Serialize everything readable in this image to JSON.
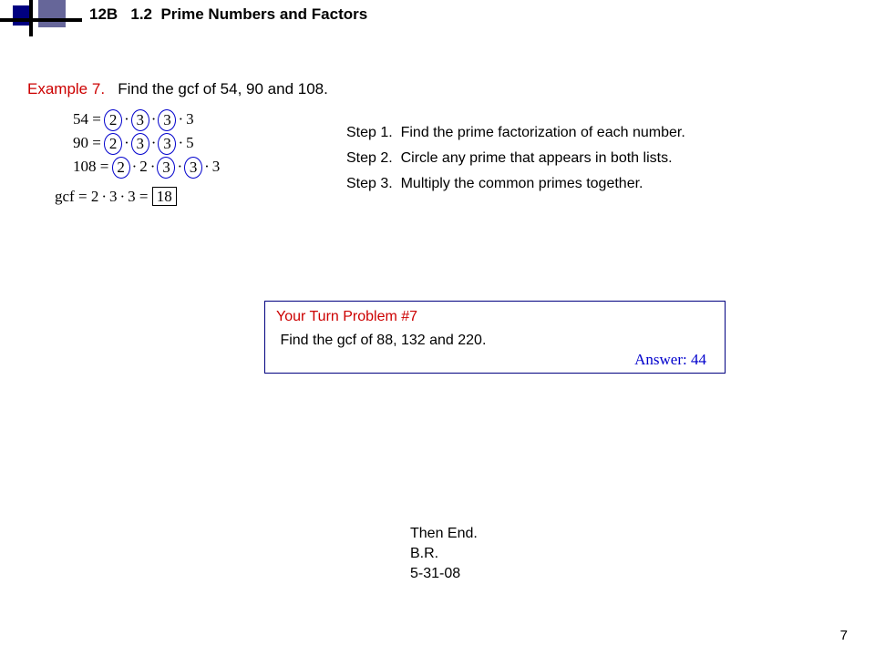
{
  "header": {
    "course": "12B",
    "section": "1.2",
    "title": "Prime Numbers and Factors"
  },
  "example": {
    "label": "Example 7.",
    "prompt": "Find the gcf of 54, 90 and 108."
  },
  "factorizations": [
    {
      "lhs": "54",
      "factors": [
        "2",
        "3",
        "3",
        "3"
      ],
      "circled": [
        true,
        true,
        true,
        false
      ]
    },
    {
      "lhs": "90",
      "factors": [
        "2",
        "3",
        "3",
        "5"
      ],
      "circled": [
        true,
        true,
        true,
        false
      ]
    },
    {
      "lhs": "108",
      "factors": [
        "2",
        "2",
        "3",
        "3",
        "3"
      ],
      "circled": [
        true,
        false,
        true,
        true,
        false
      ]
    }
  ],
  "gcf": {
    "label": "gcf",
    "expr_factors": [
      "2",
      "3",
      "3"
    ],
    "result": "18"
  },
  "steps": [
    {
      "label": "Step 1.",
      "text": "Find the prime factorization of each number."
    },
    {
      "label": "Step 2.",
      "text": "Circle any prime that appears in both lists."
    },
    {
      "label": "Step 3.",
      "text": "Multiply the common primes together."
    }
  ],
  "your_turn": {
    "title": "Your Turn Problem #7",
    "prompt": "Find the gcf of 88, 132 and 220.",
    "answer": "Answer: 44"
  },
  "ending": {
    "line1": "Then End.",
    "line2": "B.R.",
    "line3": "5-31-08"
  },
  "page_number": "7"
}
